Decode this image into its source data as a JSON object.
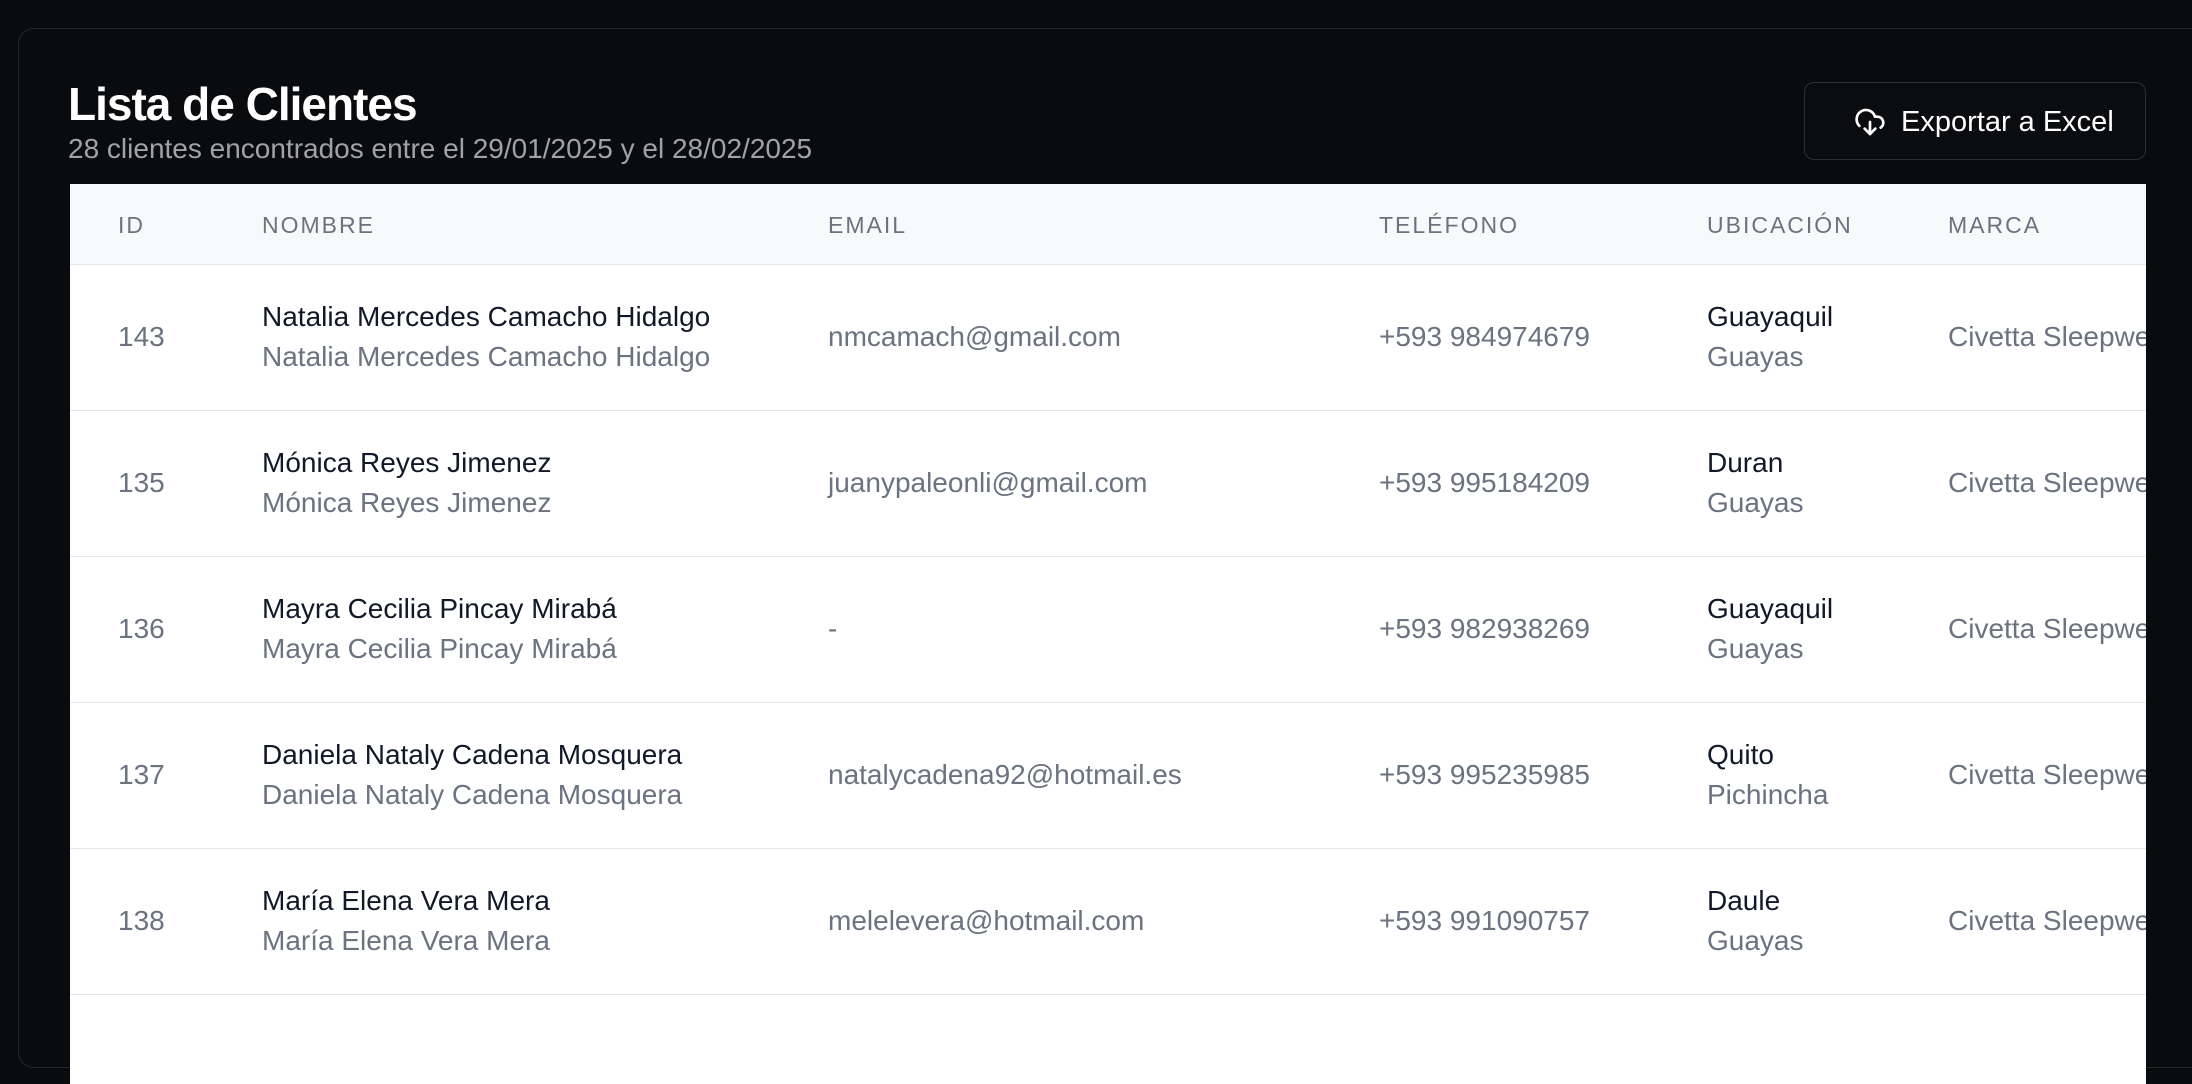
{
  "header": {
    "title": "Lista de Clientes",
    "subtitle": "28 clientes encontrados entre el 29/01/2025 y el 28/02/2025"
  },
  "toolbar": {
    "export_label": "Exportar a Excel",
    "export_icon": "cloud-download-icon"
  },
  "table": {
    "columns": [
      "ID",
      "NOMBRE",
      "EMAIL",
      "TELÉFONO",
      "UBICACIÓN",
      "MARCA"
    ],
    "rows": [
      {
        "id": "143",
        "name": "Natalia Mercedes Camacho Hidalgo",
        "name_sub": "Natalia Mercedes Camacho Hidalgo",
        "email": "nmcamach@gmail.com",
        "phone": "+593 984974679",
        "city": "Guayaquil",
        "province": "Guayas",
        "brand": "Civetta Sleepwe"
      },
      {
        "id": "135",
        "name": "Mónica Reyes Jimenez",
        "name_sub": "Mónica Reyes Jimenez",
        "email": "juanypaleonli@gmail.com",
        "phone": "+593 995184209",
        "city": "Duran",
        "province": "Guayas",
        "brand": "Civetta Sleepwe"
      },
      {
        "id": "136",
        "name": "Mayra Cecilia Pincay Mirabá",
        "name_sub": "Mayra Cecilia Pincay Mirabá",
        "email": "-",
        "phone": "+593 982938269",
        "city": "Guayaquil",
        "province": "Guayas",
        "brand": "Civetta Sleepwe"
      },
      {
        "id": "137",
        "name": "Daniela Nataly Cadena Mosquera",
        "name_sub": "Daniela Nataly Cadena Mosquera",
        "email": "natalycadena92@hotmail.es",
        "phone": "+593 995235985",
        "city": "Quito",
        "province": "Pichincha",
        "brand": "Civetta Sleepwe"
      },
      {
        "id": "138",
        "name": "María Elena Vera Mera",
        "name_sub": "María Elena Vera Mera",
        "email": "melelevera@hotmail.com",
        "phone": "+593 991090757",
        "city": "Daule",
        "province": "Guayas",
        "brand": "Civetta Sleepwe"
      }
    ]
  }
}
